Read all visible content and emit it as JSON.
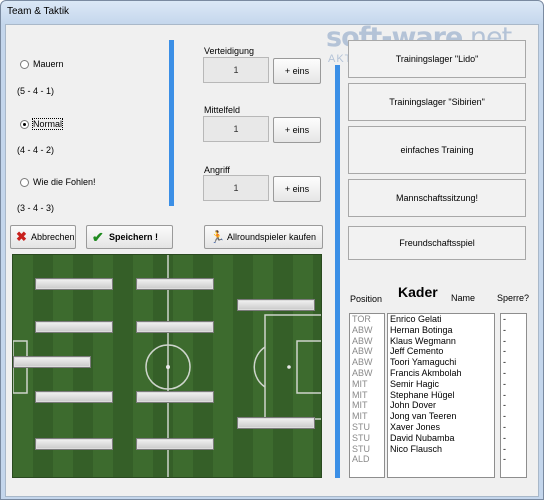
{
  "window": {
    "title": "Team & Taktik"
  },
  "watermark": {
    "brand": "soft-ware",
    "tld": ".net",
    "tagline": "AKTUELLE DOWNLOADS"
  },
  "formations": [
    {
      "label": "Mauern",
      "numbers": "(5 - 4 - 1)",
      "selected": false
    },
    {
      "label": "Normal",
      "numbers": "(4 - 4 - 2)",
      "selected": true
    },
    {
      "label": "Wie die Fohlen!",
      "numbers": "(3 - 4 - 3)",
      "selected": false
    }
  ],
  "lines": [
    {
      "label": "Verteidigung",
      "value": "1",
      "button": "+ eins"
    },
    {
      "label": "Mittelfeld",
      "value": "1",
      "button": "+ eins"
    },
    {
      "label": "Angriff",
      "value": "1",
      "button": "+ eins"
    }
  ],
  "actions": {
    "cancel": "Abbrechen",
    "save": "Speichern !",
    "buy_allrounder": "Allroundspieler kaufen"
  },
  "training_buttons": [
    "Trainingslager \"Lido\"",
    "Trainingslager \"Sibirien\"",
    "einfaches Training",
    "Mannschaftssitzung!",
    "Freundschaftsspiel"
  ],
  "squad": {
    "title": "Kader",
    "col_position": "Position",
    "col_name": "Name",
    "col_banned": "Sperre?",
    "positions": [
      "TOR",
      "ABW",
      "ABW",
      "ABW",
      "ABW",
      "ABW",
      "MIT",
      "MIT",
      "MIT",
      "MIT",
      "STU",
      "STU",
      "STU",
      "ALD"
    ],
    "names": [
      "Enrico Gelati",
      "Hernan Botinga",
      "Klaus Wegmann",
      "Jeff Cemento",
      "Toori Yamaguchi",
      "Francis Akmbolah",
      "Semir Hagic",
      "Stephane Hügel",
      "John Dover",
      "Jong van Teeren",
      "Xaver Jones",
      "David Nubamba",
      "Nico Flausch"
    ],
    "banned": [
      "-",
      "-",
      "-",
      "-",
      "-",
      "-",
      "-",
      "-",
      "-",
      "-",
      "-",
      "-",
      "-",
      "-"
    ]
  },
  "colors": {
    "accent_bar": "#3b8fe6",
    "pitch": "#3d6b2e",
    "title_bar": "#c4d6ec"
  }
}
